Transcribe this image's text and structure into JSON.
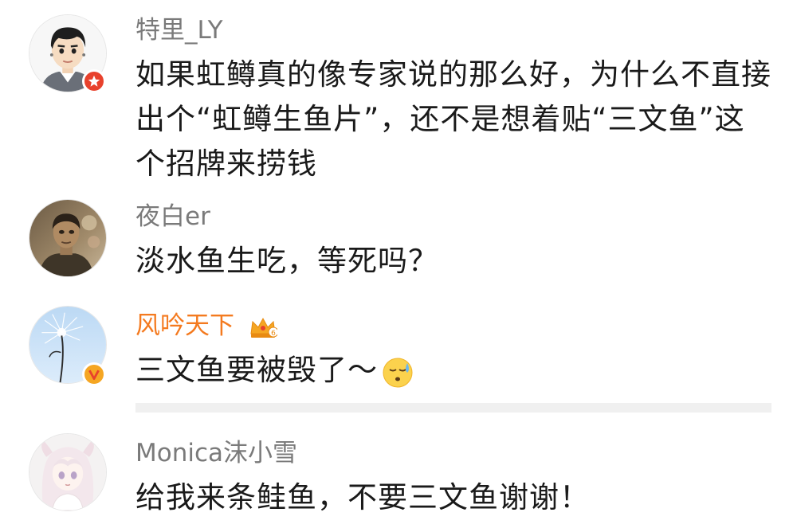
{
  "comments": [
    {
      "username": "特里_LY",
      "text": "如果虹鳟真的像专家说的那么好，为什么不直接出个“虹鳟生鱼片”，还不是想着贴“三文鱼”这个招牌来捞钱",
      "badge": "red-star-badge",
      "avatar": "cartoon-man-avatar"
    },
    {
      "username": "夜白er",
      "text": "淡水鱼生吃，等死吗？",
      "avatar": "photo-man-avatar"
    },
    {
      "username": "风吟天下",
      "text": "三文鱼要被毁了～",
      "badge": "v-badge",
      "vip_level": "6",
      "avatar": "dandelion-avatar",
      "emoji": "sweat-face-emoji"
    },
    {
      "username": "Monica沫小雪",
      "text": "给我来条鲑鱼，不要三文鱼谢谢！",
      "avatar": "anime-girl-avatar"
    }
  ],
  "colors": {
    "username": "#7a7a7a",
    "vip_username": "#f47a1f",
    "text": "#1a1a1a",
    "badge_red": "#e8412c",
    "badge_orange": "#f5a623"
  }
}
